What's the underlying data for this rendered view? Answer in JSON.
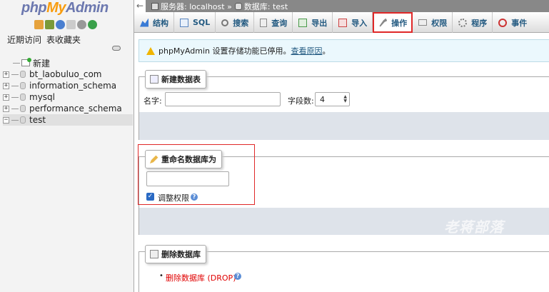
{
  "logo": {
    "php": "php",
    "my": "My",
    "admin": "Admin"
  },
  "sidebar": {
    "links": [
      "近期访问",
      "表收藏夹"
    ],
    "tree": [
      {
        "label": "新建",
        "type": "new"
      },
      {
        "label": "bt_laobuluo_com",
        "type": "db"
      },
      {
        "label": "information_schema",
        "type": "db"
      },
      {
        "label": "mysql",
        "type": "db"
      },
      {
        "label": "performance_schema",
        "type": "db"
      },
      {
        "label": "test",
        "type": "db",
        "selected": true
      }
    ]
  },
  "breadcrumb": {
    "back": "←",
    "server": "服务器: localhost »",
    "database": "数据库: test"
  },
  "tabs": [
    {
      "label": "结构",
      "icon": "structure-icon",
      "color": "#3a7bd5"
    },
    {
      "label": "SQL",
      "icon": "sql-icon",
      "color": "#5a86c0"
    },
    {
      "label": "搜索",
      "icon": "search-icon",
      "color": "#777"
    },
    {
      "label": "查询",
      "icon": "query-icon",
      "color": "#888"
    },
    {
      "label": "导出",
      "icon": "export-icon",
      "color": "#4a9a4a"
    },
    {
      "label": "导入",
      "icon": "import-icon",
      "color": "#c44"
    },
    {
      "label": "操作",
      "icon": "wrench-icon",
      "color": "#777",
      "active": true
    },
    {
      "label": "权限",
      "icon": "privileges-icon",
      "color": "#888"
    },
    {
      "label": "程序",
      "icon": "routines-icon",
      "color": "#777"
    },
    {
      "label": "事件",
      "icon": "events-icon",
      "color": "#c33"
    }
  ],
  "notice": {
    "text": "phpMyAdmin 设置存储功能已停用。",
    "link": "查看原因",
    "suffix": "。"
  },
  "create_table": {
    "legend": "新建数据表",
    "name_label": "名字:",
    "name_value": "",
    "fields_label": "字段数:",
    "fields_value": "4"
  },
  "rename_db": {
    "legend": "重命名数据库为",
    "input_value": "",
    "checkbox_label": "调整权限",
    "checked": true
  },
  "drop_db": {
    "legend": "删除数据库",
    "link": "删除数据库 (DROP)"
  },
  "watermark": "老蒋部落",
  "colors": {
    "accent": "#235a81",
    "highlight_box": "#e02828",
    "drop_link": "#e00000"
  }
}
